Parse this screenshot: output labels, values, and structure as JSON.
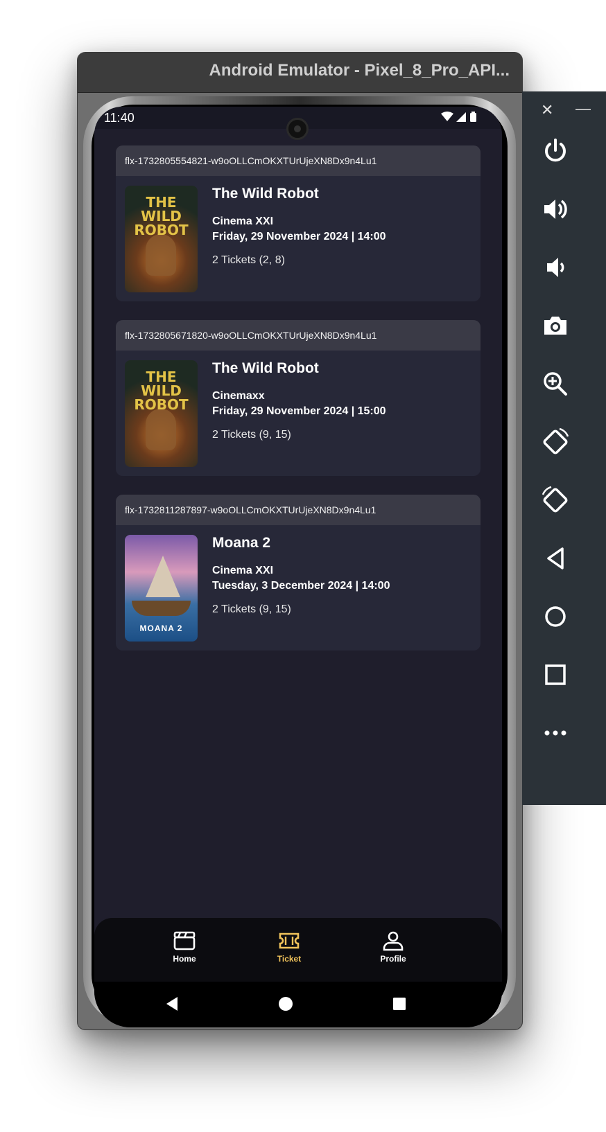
{
  "window": {
    "title": "Android Emulator - Pixel_8_Pro_API..."
  },
  "status_bar": {
    "time": "11:40",
    "icons": "▾◢▮"
  },
  "bookings": [
    {
      "booking_id": "flx-1732805554821-w9oOLLCmOKXTUrUjeXN8Dx9n4Lu1",
      "poster": "wild-robot",
      "poster_text": "THE WILD ROBOT",
      "title": "The Wild Robot",
      "cinema": "Cinema XXI",
      "datetime": "Friday, 29 November 2024 | 14:00",
      "tickets": "2 Tickets (2, 8)"
    },
    {
      "booking_id": "flx-1732805671820-w9oOLLCmOKXTUrUjeXN8Dx9n4Lu1",
      "poster": "wild-robot",
      "poster_text": "THE WILD ROBOT",
      "title": "The Wild Robot",
      "cinema": "Cinemaxx",
      "datetime": "Friday, 29 November 2024 | 15:00",
      "tickets": "2 Tickets (9, 15)"
    },
    {
      "booking_id": "flx-1732811287897-w9oOLLCmOKXTUrUjeXN8Dx9n4Lu1",
      "poster": "moana-2",
      "poster_text": "MOANA 2",
      "title": "Moana 2",
      "cinema": "Cinema XXI",
      "datetime": "Tuesday, 3 December 2024 | 14:00",
      "tickets": "2 Tickets (9, 15)"
    }
  ],
  "bottom_nav": {
    "active": "Ticket",
    "active_color": "#f0c35b",
    "items": [
      {
        "label": "Home",
        "icon": "clapperboard-icon"
      },
      {
        "label": "Ticket",
        "icon": "ticket-icon"
      },
      {
        "label": "Profile",
        "icon": "person-icon"
      }
    ]
  },
  "emulator_controls": {
    "close": "✕",
    "minimize": "—",
    "buttons": [
      "power-icon",
      "volume-up-icon",
      "volume-down-icon",
      "camera-icon",
      "zoom-icon",
      "rotate-left-icon",
      "rotate-right-icon",
      "back-icon",
      "home-icon",
      "overview-icon",
      "more-icon"
    ]
  },
  "colors": {
    "screen_bg": "#1f1e2c",
    "card_bg": "#272838",
    "card_header_bg": "#3a3a46",
    "accent": "#f0c35b",
    "side_panel_bg": "#2b3238"
  }
}
